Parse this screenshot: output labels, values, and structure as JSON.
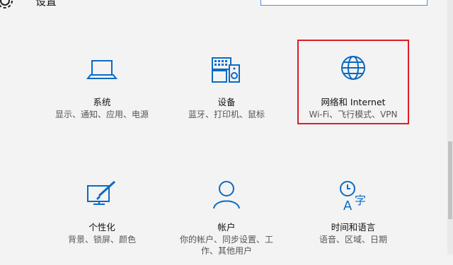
{
  "window": {
    "title": "设置",
    "search_placeholder": ""
  },
  "accent": "#0a6ac4",
  "highlight_color": "#e01b24",
  "tiles": [
    {
      "name": "系统",
      "desc": "显示、通知、应用、电源",
      "icon": "laptop-icon"
    },
    {
      "name": "设备",
      "desc": "蓝牙、打印机、鼠标",
      "icon": "devices-icon"
    },
    {
      "name": "网络和 Internet",
      "desc": "Wi-Fi、飞行模式、VPN",
      "icon": "globe-icon"
    },
    {
      "name": "个性化",
      "desc": "背景、锁屏、颜色",
      "icon": "personalize-icon"
    },
    {
      "name": "帐户",
      "desc": "你的帐户、同步设置、工作、其他用户",
      "icon": "person-icon"
    },
    {
      "name": "时间和语言",
      "desc": "语音、区域、日期",
      "icon": "time-language-icon"
    }
  ]
}
